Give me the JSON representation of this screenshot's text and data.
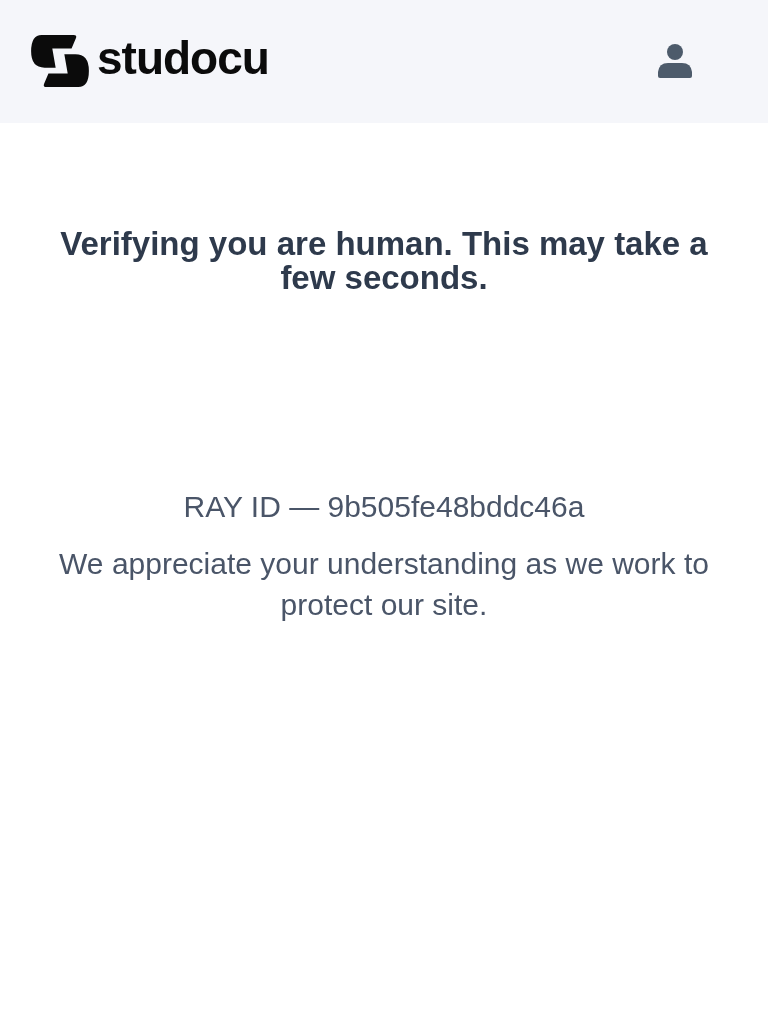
{
  "header": {
    "brand": "studocu"
  },
  "main": {
    "heading": "Verifying you are human. This may take a few seconds.",
    "ray_id": "RAY ID — 9b505fe48bddc46a",
    "message": "We appreciate your understanding as we work to protect our site."
  }
}
